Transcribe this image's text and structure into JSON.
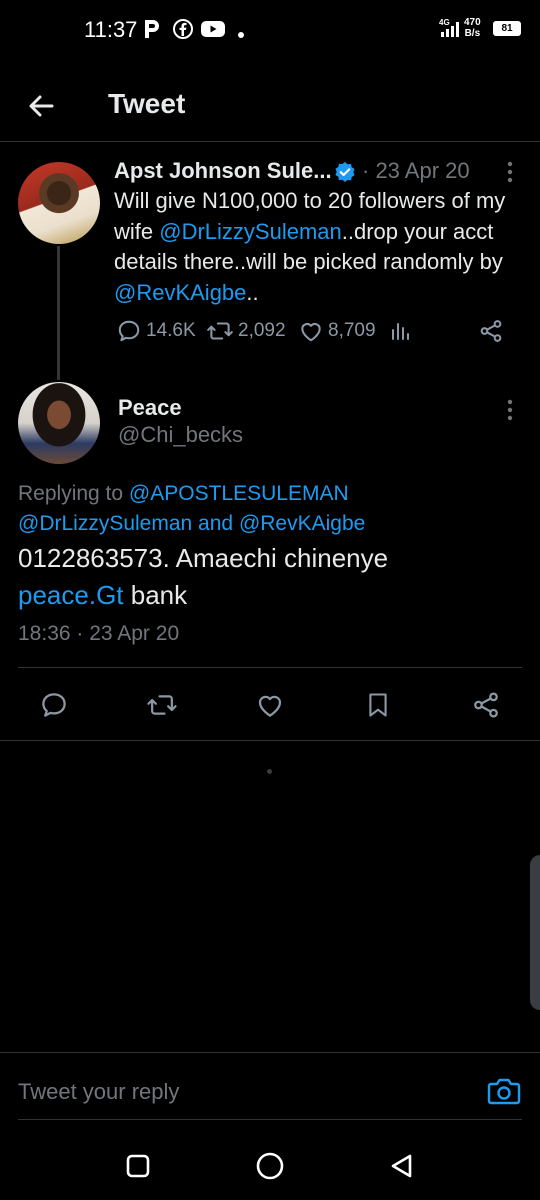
{
  "status_bar": {
    "time": "11:37",
    "net_speed_value": "470",
    "net_speed_unit": "B/s",
    "battery": "81",
    "network_type": "4G"
  },
  "header": {
    "title": "Tweet"
  },
  "original_tweet": {
    "author_name": "Apst Johnson Sule...",
    "date": "· 23 Apr 20",
    "text_part1": "Will give N100,000 to 20 followers of my wife ",
    "mention1": "@DrLizzySuleman",
    "text_part2": "..drop your acct details there..will be picked randomly by ",
    "mention2": "@RevKAigbe",
    "text_part3": "..",
    "replies": "14.6K",
    "retweets": "2,092",
    "likes": "8,709"
  },
  "reply_tweet": {
    "author_name": "Peace",
    "handle": "@Chi_becks",
    "replying_prefix": "Replying to ",
    "replying_mention1": "@APOSTLESULEMAN",
    "replying_mention2": "@DrLizzySuleman",
    "replying_and": " and ",
    "replying_mention3": "@RevKAigbe",
    "text_part1": "0122863573. Amaechi chinenye ",
    "text_link": "peace.Gt",
    "text_part2": " bank",
    "timestamp": "18:36 · 23 Apr 20"
  },
  "composer": {
    "placeholder": "Tweet your reply"
  },
  "colors": {
    "background": "#000000",
    "text": "#e7e9ea",
    "muted": "#71767b",
    "accent": "#1d9bf0"
  }
}
